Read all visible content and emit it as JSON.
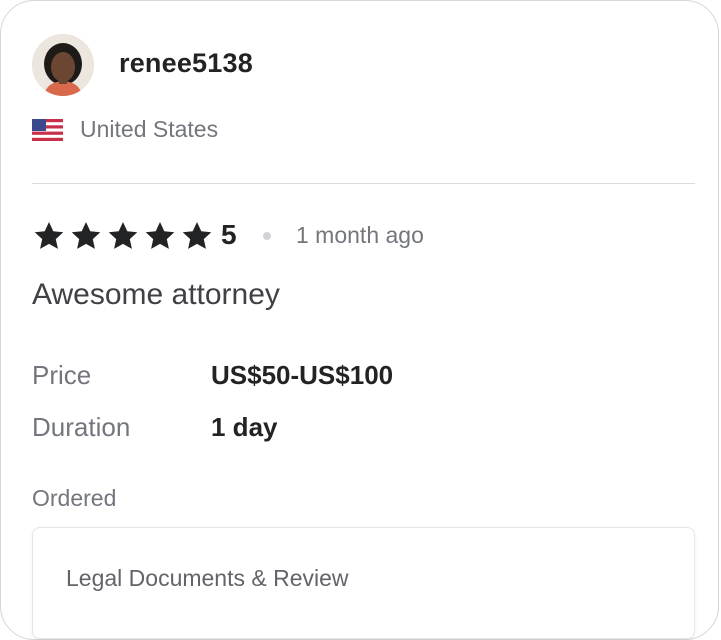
{
  "reviewer": {
    "username": "renee5138",
    "country": "United States",
    "flag_icon": "us-flag-icon"
  },
  "review": {
    "star_count": 5,
    "rating": "5",
    "time_ago": "1 month ago",
    "title": "Awesome attorney",
    "star_color": "#222325"
  },
  "details": {
    "price_label": "Price",
    "price_value": "US$50-US$100",
    "duration_label": "Duration",
    "duration_value": "1 day"
  },
  "ordered": {
    "label": "Ordered",
    "item": "Legal Documents & Review"
  }
}
